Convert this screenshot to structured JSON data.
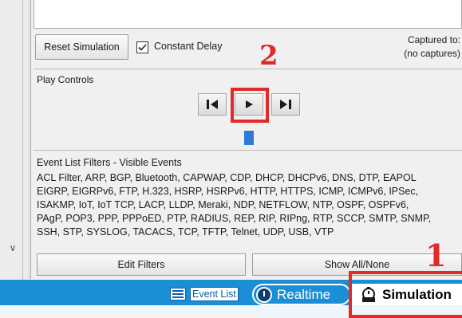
{
  "controls": {
    "reset_label": "Reset Simulation",
    "constant_delay_label": "Constant Delay",
    "constant_delay_checked": true,
    "captured_to_label": "Captured to:",
    "captured_to_value": "(no captures)"
  },
  "play_controls": {
    "title": "Play Controls",
    "buttons": [
      "back-icon",
      "play-icon",
      "forward-icon"
    ]
  },
  "filters": {
    "title": "Event List Filters - Visible Events",
    "lines": [
      "ACL Filter, ARP, BGP, Bluetooth, CAPWAP, CDP, DHCP, DHCPv6, DNS, DTP, EAPOL",
      "EIGRP, EIGRPv6, FTP, H.323, HSRP, HSRPv6, HTTP, HTTPS, ICMP, ICMPv6, IPSec,",
      "ISAKMP, IoT, IoT TCP, LACP, LLDP, Meraki, NDP, NETFLOW, NTP, OSPF, OSPFv6,",
      "PAgP, POP3, PPP, PPPoED, PTP, RADIUS, REP, RIP, RIPng, RTP, SCCP, SMTP, SNMP,",
      "SSH, STP, SYSLOG, TACACS, TCP, TFTP, Telnet, UDP, USB, VTP"
    ],
    "edit_label": "Edit Filters",
    "show_all_label": "Show All/None"
  },
  "mode_bar": {
    "event_list_label": "Event List",
    "realtime_label": "Realtime",
    "simulation_label": "Simulation",
    "active_mode": "Simulation"
  },
  "annotations": {
    "label_1": "1",
    "label_2": "2",
    "highlight_color": "#e12b2b"
  },
  "colors": {
    "mode_bar": "#1b8fd6",
    "progress": "#2e7ad6"
  }
}
